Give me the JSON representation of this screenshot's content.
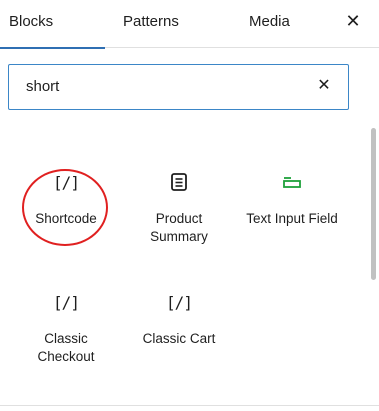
{
  "tabs": [
    {
      "label": "Blocks",
      "active": true
    },
    {
      "label": "Patterns",
      "active": false
    },
    {
      "label": "Media",
      "active": false
    }
  ],
  "close_icon": "close-icon",
  "search": {
    "value": "short",
    "placeholder": "Search",
    "clear_icon": "close-icon"
  },
  "blocks": [
    {
      "label": "Shortcode",
      "icon": "shortcode-icon",
      "glyph": "[/]"
    },
    {
      "label": "Product\nSummary",
      "icon": "document-icon"
    },
    {
      "label": "Text Input Field",
      "icon": "text-input-icon"
    },
    {
      "label": "Classic\nCheckout",
      "icon": "shortcode-icon",
      "glyph": "[/]"
    },
    {
      "label": "Classic Cart",
      "icon": "shortcode-icon",
      "glyph": "[/]"
    }
  ],
  "colors": {
    "accent": "#2f6fb3",
    "search_border": "#3b86c7",
    "highlight": "#e02020",
    "text_input_icon": "#1ea03a"
  }
}
